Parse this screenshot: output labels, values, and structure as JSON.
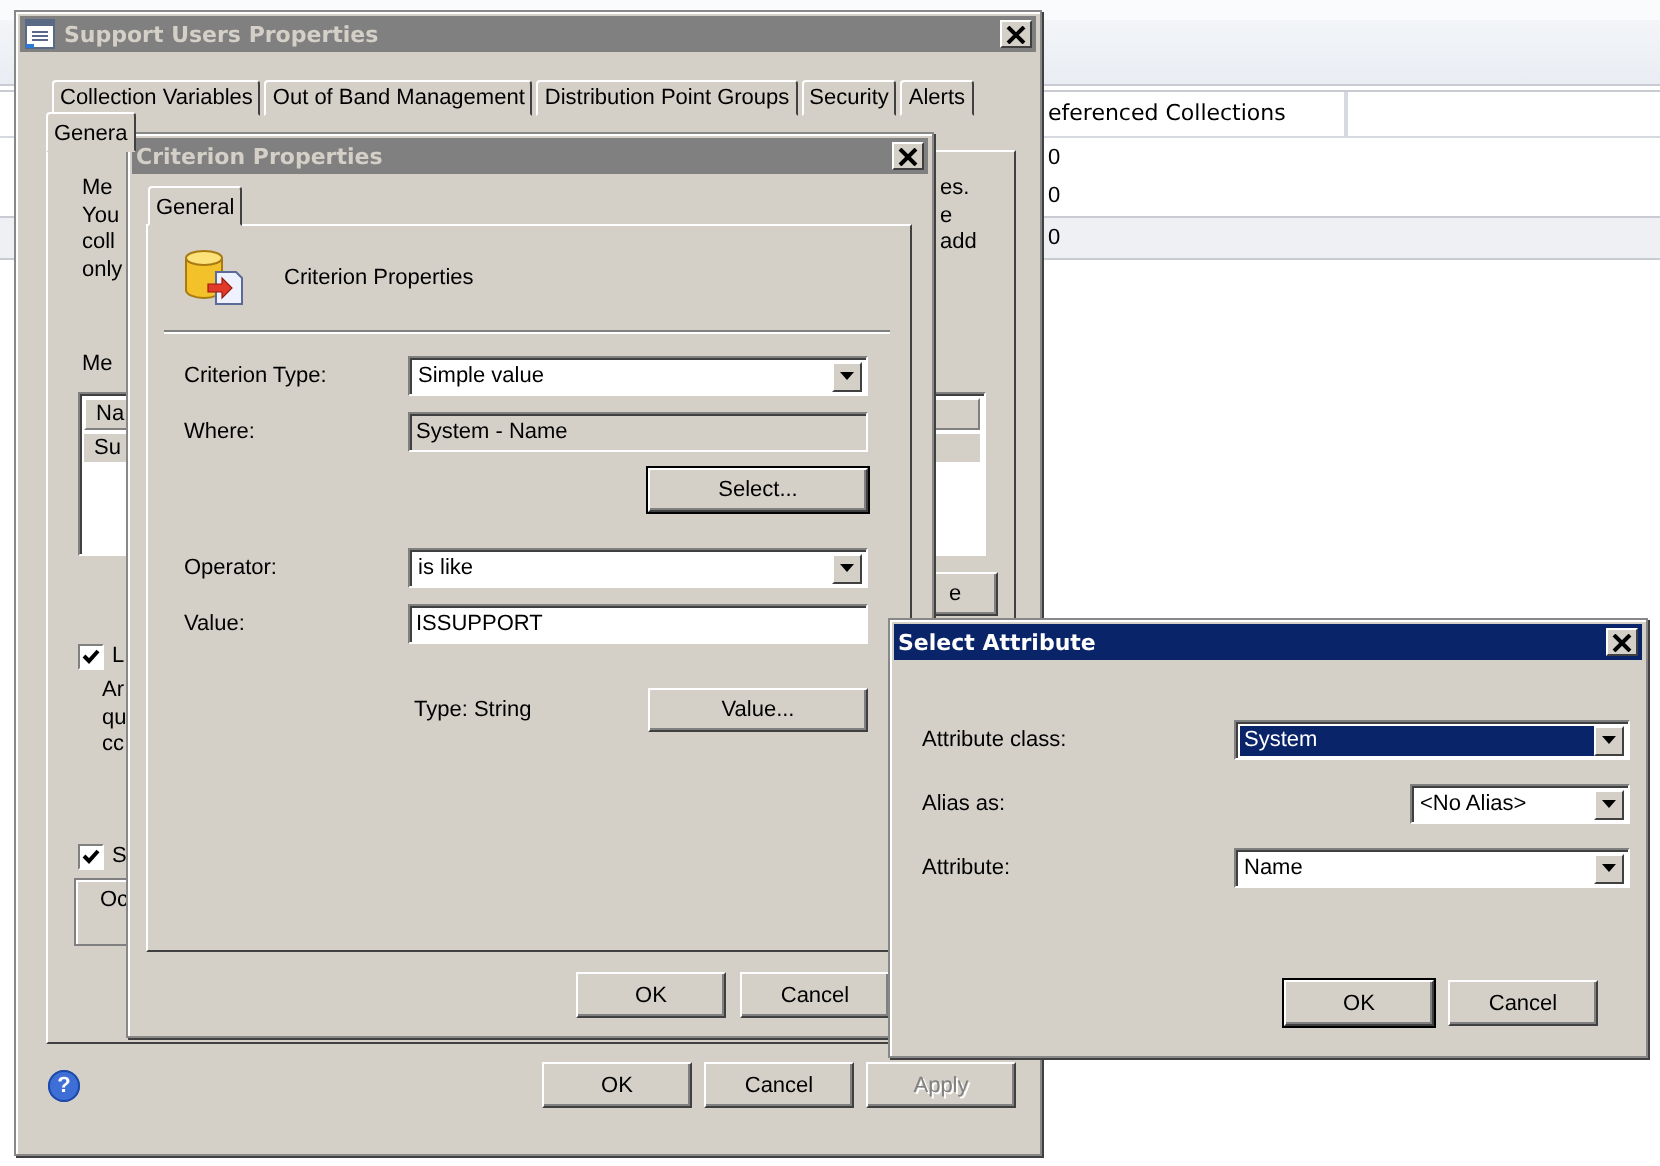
{
  "background_app": {
    "column_header": "eferenced Collections",
    "rows": [
      {
        "cell": "0",
        "selected": false
      },
      {
        "cell": "0",
        "selected": false
      },
      {
        "cell": "0",
        "selected": true
      }
    ]
  },
  "main_dialog": {
    "title": "Support Users Properties",
    "active": false,
    "tabs_row_1": [
      {
        "label": "Collection Variables",
        "selected": false
      },
      {
        "label": "Out of Band Management",
        "selected": false
      },
      {
        "label": "Distribution Point Groups",
        "selected": false
      },
      {
        "label": "Security",
        "selected": false
      },
      {
        "label": "Alerts",
        "selected": false
      }
    ],
    "tabs_row_2": [
      {
        "label": "Genera",
        "selected": true
      }
    ],
    "description_left": [
      "Me",
      "You",
      "coll",
      "only"
    ],
    "description_right": [
      "es.",
      "e",
      "add"
    ],
    "members_label": "Me",
    "members_list": {
      "column": "Na",
      "rows": [
        {
          "cell": "Su",
          "selected": true
        }
      ]
    },
    "side_button": "e",
    "options": [
      {
        "label": "L",
        "checked": true,
        "lines": [
          "Ar",
          "qu",
          "cc"
        ]
      },
      {
        "label": "S",
        "checked": true,
        "lines": [
          "Oc"
        ]
      }
    ],
    "help_icon": "?",
    "buttons": [
      {
        "label": "OK",
        "disabled": false
      },
      {
        "label": "Cancel",
        "disabled": false
      },
      {
        "label": "Apply",
        "disabled": true
      }
    ]
  },
  "criterion_dialog": {
    "title": "Criterion Properties",
    "active": false,
    "tabs": [
      {
        "label": "General",
        "selected": true
      }
    ],
    "heading": "Criterion Properties",
    "criterion_type": {
      "label": "Criterion Type:",
      "value": "Simple value"
    },
    "where": {
      "label": "Where:",
      "value": "System - Name"
    },
    "select_button": "Select...",
    "operator": {
      "label": "Operator:",
      "value": "is like"
    },
    "value_field": {
      "label": "Value:",
      "value": "ISSUPPORT"
    },
    "type_label": "Type: String",
    "value_button": "Value...",
    "buttons": [
      {
        "label": "OK",
        "default": false
      },
      {
        "label": "Cancel",
        "default": false
      }
    ]
  },
  "select_attribute_dialog": {
    "title": "Select Attribute",
    "active": true,
    "fields": [
      {
        "label": "Attribute class:",
        "value": "System",
        "kind": "wide",
        "focused": true
      },
      {
        "label": "Alias as:",
        "value": "<No Alias>",
        "kind": "narrow",
        "focused": false
      },
      {
        "label": "Attribute:",
        "value": "Name",
        "kind": "wide",
        "focused": false
      }
    ],
    "buttons": [
      {
        "label": "OK",
        "default": true
      },
      {
        "label": "Cancel",
        "default": false
      }
    ]
  }
}
